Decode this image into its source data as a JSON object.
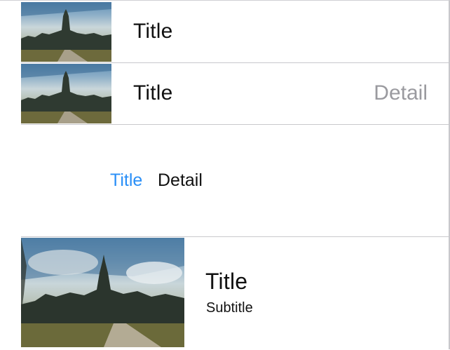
{
  "cells": [
    {
      "style": "default",
      "title": "Title",
      "image": "castle-thumbnail"
    },
    {
      "style": "value1",
      "title": "Title",
      "detail": "Detail",
      "image": "castle-thumbnail"
    },
    {
      "style": "value2",
      "title": "Title",
      "detail": "Detail"
    },
    {
      "style": "subtitle",
      "title": "Title",
      "subtitle": "Subtitle",
      "image": "castle-thumbnail"
    }
  ],
  "colors": {
    "tint": "#2a8ff7",
    "detail_gray": "#9a9a9f",
    "separator": "#c8c8cc"
  }
}
